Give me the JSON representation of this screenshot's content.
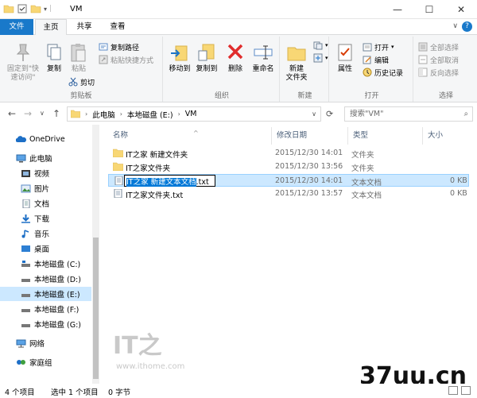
{
  "window": {
    "title": "VM",
    "minimize_glyph": "—",
    "maximize_glyph": "☐",
    "close_glyph": "✕"
  },
  "ribbon_tabs": [
    "文件",
    "主页",
    "共享",
    "查看"
  ],
  "ribbon_toggle_glyph": "∨",
  "help_glyph": "?",
  "ribbon": {
    "clipboard": {
      "label": "剪贴板",
      "pin_quick_access": "固定到\"快\n速访问\"",
      "copy": "复制",
      "paste": "粘贴",
      "copy_path": "复制路径",
      "paste_shortcut": "粘贴快捷方式",
      "cut": "剪切"
    },
    "organize": {
      "label": "组织",
      "move_to": "移动到",
      "copy_to": "复制到",
      "delete": "删除",
      "rename": "重命名"
    },
    "new": {
      "label": "新建",
      "new_folder": "新建\n文件夹"
    },
    "open": {
      "label": "打开",
      "properties": "属性",
      "open": "打开",
      "edit": "编辑",
      "history": "历史记录"
    },
    "select": {
      "label": "选择",
      "select_all": "全部选择",
      "select_none": "全部取消",
      "invert": "反向选择"
    }
  },
  "address": {
    "segments": [
      "此电脑",
      "本地磁盘 (E:)",
      "VM"
    ],
    "search_placeholder": "搜索\"VM\""
  },
  "nav": {
    "back": "←",
    "forward": "→",
    "dropdown": "∨",
    "up": "↑",
    "refresh": "⟳",
    "items": [
      {
        "label": "OneDrive"
      },
      {
        "label": "此电脑"
      },
      {
        "label": "视频"
      },
      {
        "label": "图片"
      },
      {
        "label": "文档"
      },
      {
        "label": "下载"
      },
      {
        "label": "音乐"
      },
      {
        "label": "桌面"
      },
      {
        "label": "本地磁盘 (C:)"
      },
      {
        "label": "本地磁盘 (D:)"
      },
      {
        "label": "本地磁盘 (E:)"
      },
      {
        "label": "本地磁盘 (F:)"
      },
      {
        "label": "本地磁盘 (G:)"
      },
      {
        "label": "网络"
      },
      {
        "label": "家庭组"
      }
    ]
  },
  "columns": [
    "名称",
    "修改日期",
    "类型",
    "大小"
  ],
  "sort_glyph": "^",
  "files": [
    {
      "name": "IT之家 新建文件夹",
      "date": "2015/12/30 14:01",
      "type": "文件夹",
      "size": ""
    },
    {
      "name": "IT之家文件夹",
      "date": "2015/12/30 13:56",
      "type": "文件夹",
      "size": ""
    },
    {
      "name_selected": "IT之家 新建文本文档",
      "name_ext": ".txt",
      "date": "2015/12/30 14:01",
      "type": "文本文档",
      "size": "0 KB"
    },
    {
      "name": "IT之家文件夹.txt",
      "date": "2015/12/30 13:57",
      "type": "文本文档",
      "size": "0 KB"
    }
  ],
  "status": {
    "count": "4 个项目",
    "selected": "选中 1 个项目",
    "size": "0 字节"
  },
  "watermarks": {
    "ithome_logo": "IT之",
    "ithome_url": "www.ithome.com",
    "site": "37uu.cn"
  }
}
